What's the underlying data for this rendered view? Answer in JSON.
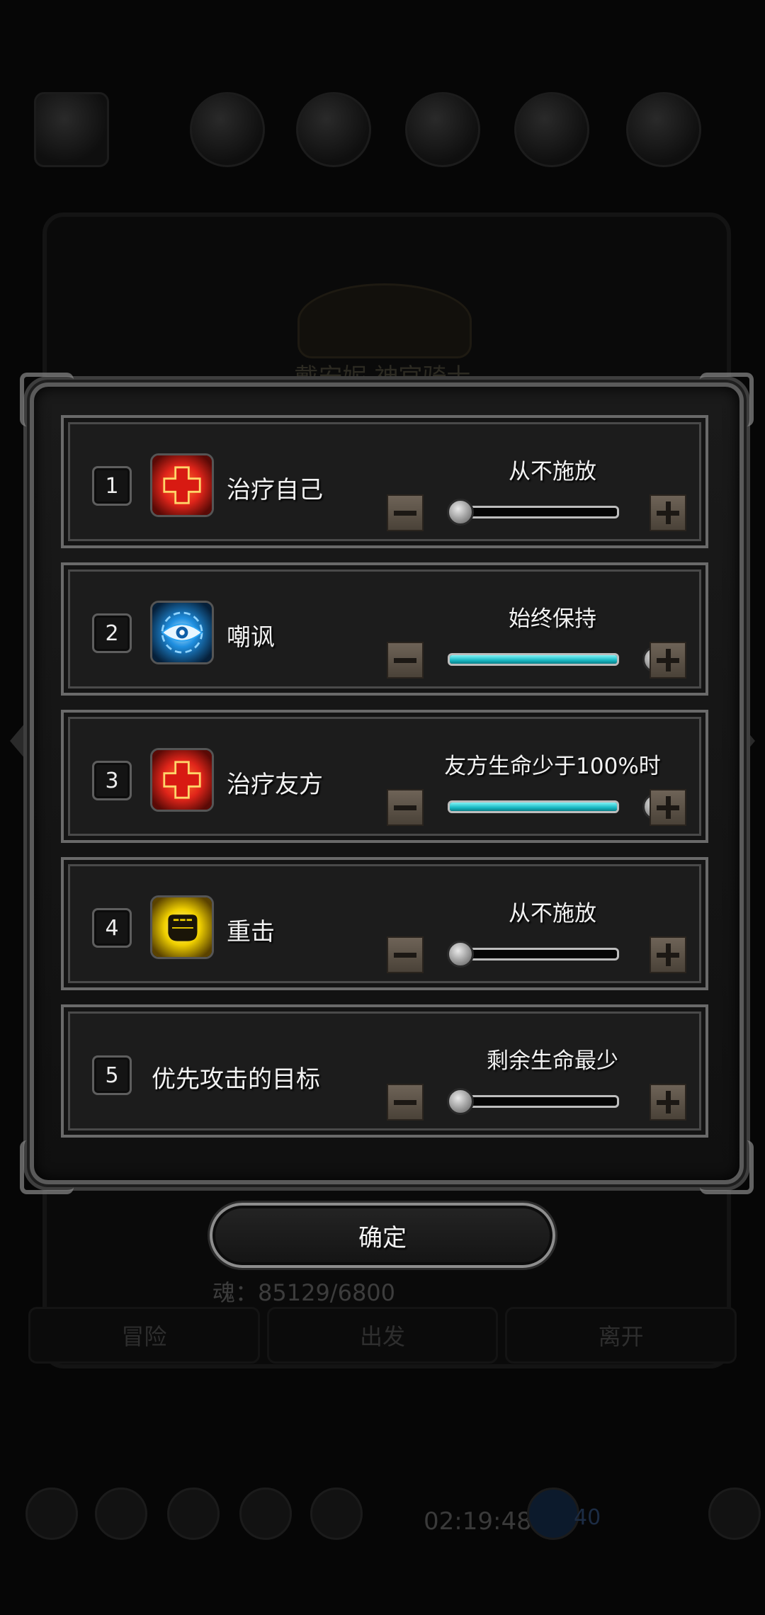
{
  "background": {
    "name_text": "戴安妮 神官骑士",
    "soul_text": "魂：85129/6800",
    "tabs": [
      "冒险",
      "出发",
      "离开"
    ],
    "time": "02:19:48",
    "gem_count": "40"
  },
  "modal": {
    "rows": [
      {
        "number": "1",
        "icon": "heal-self-icon",
        "name": "治疗自己",
        "setting": "从不施放",
        "level": 0
      },
      {
        "number": "2",
        "icon": "taunt-eye-icon",
        "name": "嘲讽",
        "setting": "始终保持",
        "level": 1
      },
      {
        "number": "3",
        "icon": "heal-ally-icon",
        "name": "治疗友方",
        "setting": "友方生命少于100%时",
        "level": 1
      },
      {
        "number": "4",
        "icon": "fist-strike-icon",
        "name": "重击",
        "setting": "从不施放",
        "level": 0
      },
      {
        "number": "5",
        "icon": "",
        "name": "优先攻击的目标",
        "setting": "剩余生命最少",
        "level": 0
      }
    ],
    "confirm_label": "确定"
  },
  "colors": {
    "slider_fill": "#19b7c2",
    "heal_red": "#e0251a",
    "taunt_blue": "#1f8fe0",
    "strike_yellow": "#f0d000"
  }
}
